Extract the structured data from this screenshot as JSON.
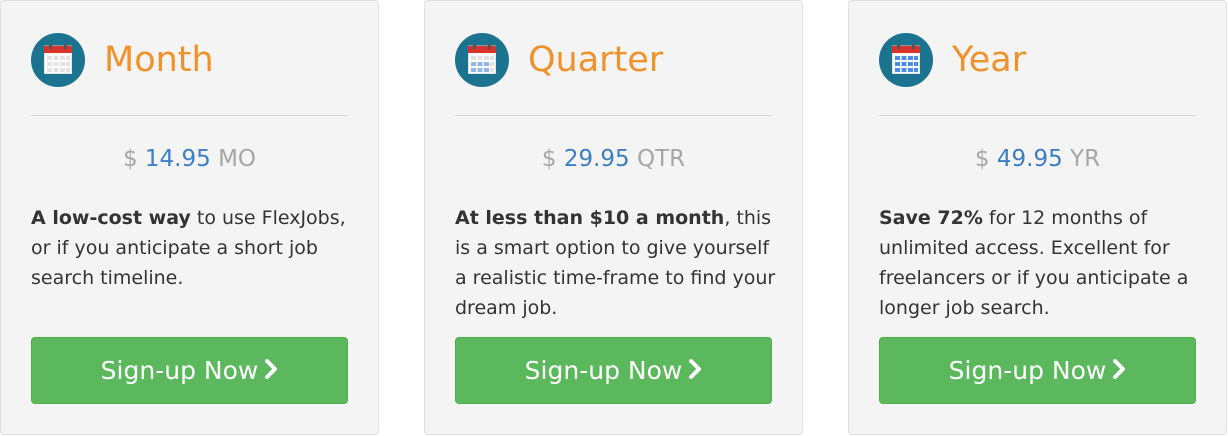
{
  "plans": [
    {
      "name": "Month",
      "currency": "$",
      "amount": "14.95",
      "unit": "MO",
      "desc_bold": "A low-cost way",
      "desc_rest": " to use FlexJobs, or if you anticipate a short job search timeline.",
      "button_label": "Sign-up Now",
      "icon": "calendar-icon"
    },
    {
      "name": "Quarter",
      "currency": "$",
      "amount": "29.95",
      "unit": "QTR",
      "desc_bold": "At less than $10 a month",
      "desc_rest": ", this is a smart option to give yourself a realistic time-frame to find your dream job.",
      "button_label": "Sign-up Now",
      "icon": "calendar-icon"
    },
    {
      "name": "Year",
      "currency": "$",
      "amount": "49.95",
      "unit": "YR",
      "desc_bold": "Save 72%",
      "desc_rest": " for 12 months of unlimited access. Excellent for freelancers or if you anticipate a longer job search.",
      "button_label": "Sign-up Now",
      "icon": "calendar-icon"
    }
  ],
  "colors": {
    "accent_orange": "#f0922b",
    "price_blue": "#3b7ec3",
    "button_green": "#5cb85c",
    "icon_teal": "#1b7390"
  }
}
